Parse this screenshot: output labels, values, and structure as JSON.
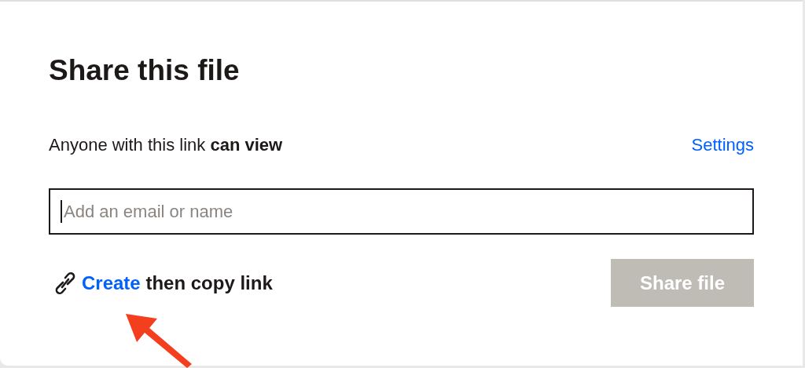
{
  "dialog": {
    "title": "Share this file",
    "access_text": "Anyone with this link **can view**",
    "settings_link": "Settings",
    "recipient_field": {
      "placeholder": "Add an email or name",
      "focused": true
    },
    "create_link": {
      "link": "Create",
      "rest": "then copy link"
    },
    "share_button": {
      "label": "Share file",
      "disabled": true
    }
  }
}
